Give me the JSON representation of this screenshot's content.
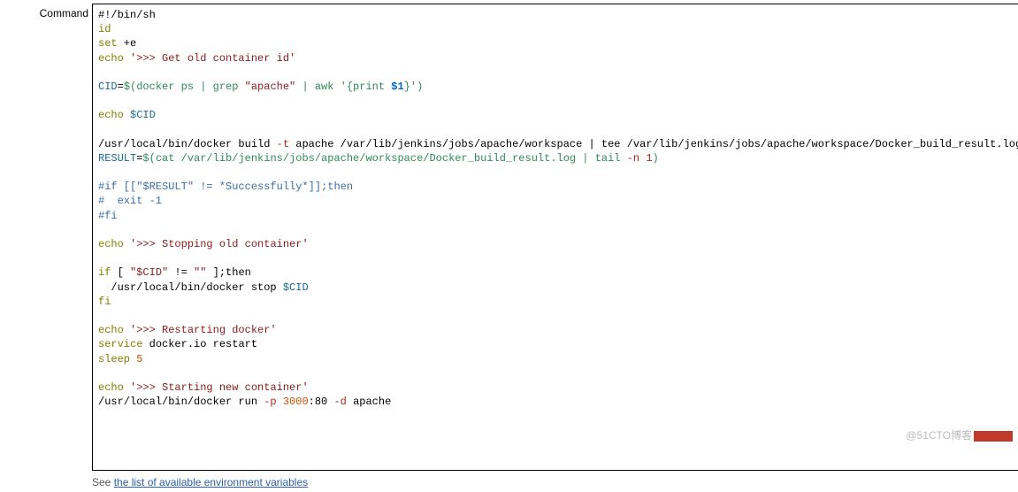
{
  "field": {
    "label": "Command"
  },
  "code": {
    "l01": "#!/bin/sh",
    "l02": "id",
    "l03_cmd": "set",
    "l03_flag": " +e",
    "l04_cmd": "echo",
    "l04_str": " '>>> Get old container id'",
    "l06_var": "CID",
    "l06_eq": "=",
    "l06_subst_a": "$(docker ps | grep ",
    "l06_subst_q": "\"apache\"",
    "l06_subst_b": " | awk '{print ",
    "l06_subst_arg": "$1",
    "l06_subst_c": "}')",
    "l08_cmd": "echo",
    "l08_var": " $CID",
    "l10_a": "/usr/local/bin/docker build ",
    "l10_flag_t": "-t",
    "l10_b": " apache /var/lib/jenkins/jobs/apache/workspace | tee /var/lib/jenkins/jobs/apache/workspace/Docker_build_result.log",
    "l11_var": "RESULT",
    "l11_eq": "=",
    "l11_subst_a": "$(cat /var/lib/jenkins/jobs/apache/workspace/Docker_build_result.log | tail ",
    "l11_flag": "-n 1",
    "l11_subst_b": ")",
    "l13": "#if [[\"$RESULT\" != *Successfully*]];then",
    "l14": "#  exit -1",
    "l15": "#fi",
    "l17_cmd": "echo",
    "l17_str": " '>>> Stopping old container'",
    "l19_cmd": "if",
    "l19_a": " [ ",
    "l19_var": "\"$CID\"",
    "l19_b": " != ",
    "l19_q": "\"\"",
    "l19_c": " ];then",
    "l20_a": "  /usr/local/bin/docker stop ",
    "l20_var": "$CID",
    "l21_cmd": "fi",
    "l23_cmd": "echo",
    "l23_str": " '>>> Restarting docker'",
    "l24_cmd": "service",
    "l24_rest": " docker.io restart",
    "l25_cmd": "sleep",
    "l25_num": " 5",
    "l27_cmd": "echo",
    "l27_str": " '>>> Starting new container'",
    "l28_a": "/usr/local/bin/docker run ",
    "l28_flag_p": "-p",
    "l28_port": " 3000",
    "l28_b": ":80 ",
    "l28_flag_d": "-d",
    "l28_c": " apache"
  },
  "help": {
    "prefix": "See ",
    "link": "the list of available environment variables"
  },
  "watermark": {
    "text": "@51CTO博客"
  }
}
